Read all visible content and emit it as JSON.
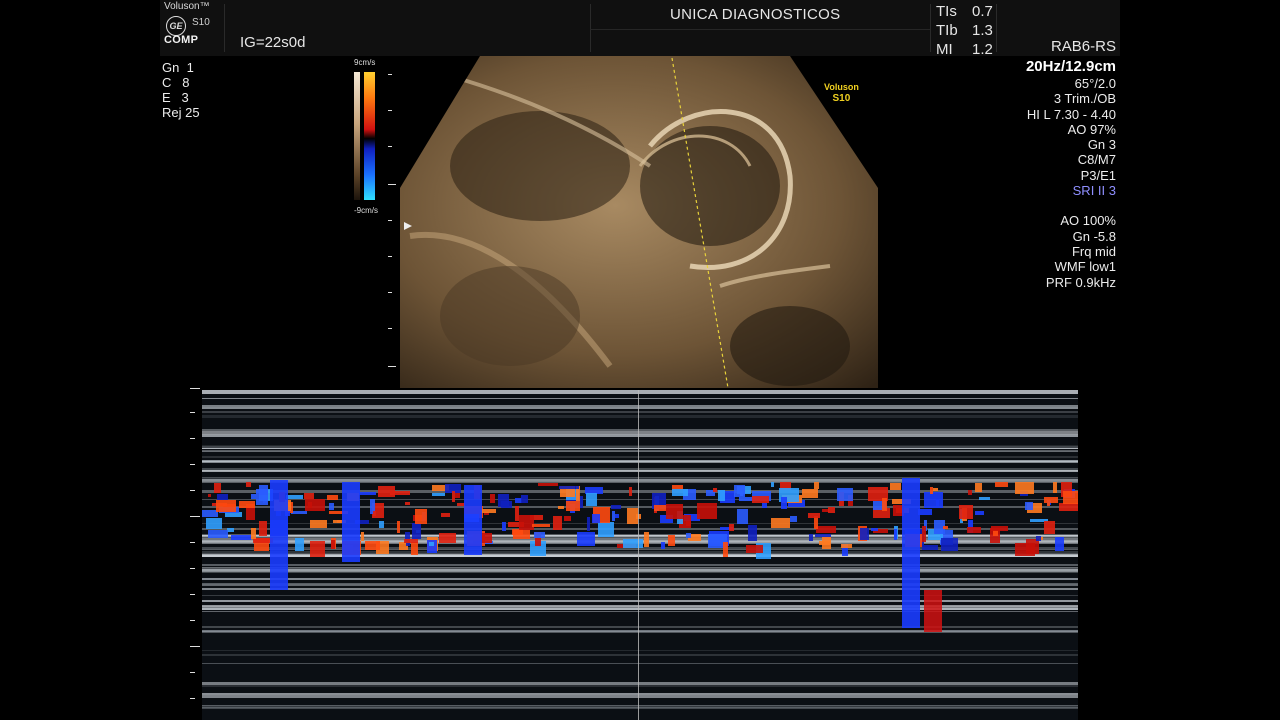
{
  "header": {
    "brand": "Voluson™",
    "model": "S10",
    "logo_text": "GE",
    "mode_badge": "COMP",
    "gestational_age": "IG=22s0d",
    "clinic_name": "UNICA DIAGNOSTICOS",
    "probe": "RAB6-RS"
  },
  "acoustic": [
    {
      "label": "TIs",
      "value": "0.7"
    },
    {
      "label": "TIb",
      "value": "1.3"
    },
    {
      "label": "MI",
      "value": "1.2"
    }
  ],
  "left_params": [
    {
      "label": "Gn",
      "value": "1"
    },
    {
      "label": "C",
      "value": "8"
    },
    {
      "label": "E",
      "value": "3"
    },
    {
      "label": "Rej",
      "value": "25"
    }
  ],
  "right_params": {
    "frame": "20Hz/12.9cm",
    "lines": [
      "65°/2.0",
      "3 Trim./OB",
      "HI L 7.30 - 4.40",
      "AO 97%",
      "Gn  3",
      "C8/M7",
      "P3/E1"
    ],
    "sri": "SRI II 3",
    "color_lines": [
      "AO 100%",
      "Gn -5.8",
      "Frq mid",
      "WMF low1",
      "PRF  0.9kHz"
    ]
  },
  "color_scale": {
    "top": "9cm/s",
    "bottom": "-9cm/s"
  },
  "overlay": {
    "voluson_label": "Voluson",
    "voluson_model": "S10"
  },
  "colors": {
    "doppler_red": "#e02010",
    "doppler_blue": "#1a3cff",
    "bmode_tint": "#a88a62"
  }
}
